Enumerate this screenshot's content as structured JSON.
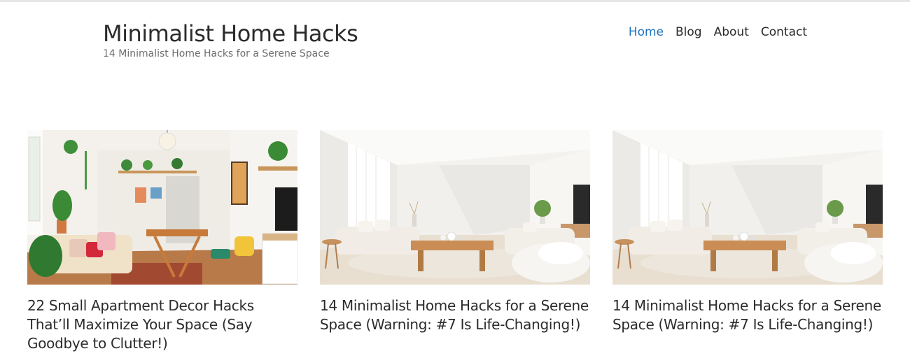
{
  "header": {
    "site_title": "Minimalist Home Hacks",
    "tagline": "14 Minimalist Home Hacks for a Serene Space"
  },
  "nav": {
    "items": [
      {
        "label": "Home",
        "active": true
      },
      {
        "label": "Blog",
        "active": false
      },
      {
        "label": "About",
        "active": false
      },
      {
        "label": "Contact",
        "active": false
      }
    ]
  },
  "posts": [
    {
      "title": "22 Small Apartment Decor Hacks That’ll Maximize Your Space (Say Goodbye to Clutter!)",
      "image": "colorful-living-room-photo"
    },
    {
      "title": "14 Minimalist Home Hacks for a Serene Space (Warning: #7 Is Life-Changing!)",
      "image": "white-minimalist-living-room-photo"
    },
    {
      "title": "14 Minimalist Home Hacks for a Serene Space (Warning: #7 Is Life-Changing!)",
      "image": "white-minimalist-living-room-photo"
    }
  ],
  "colors": {
    "accent": "#1e73be",
    "text": "#2b2b2b",
    "muted": "#6f6f6f"
  }
}
